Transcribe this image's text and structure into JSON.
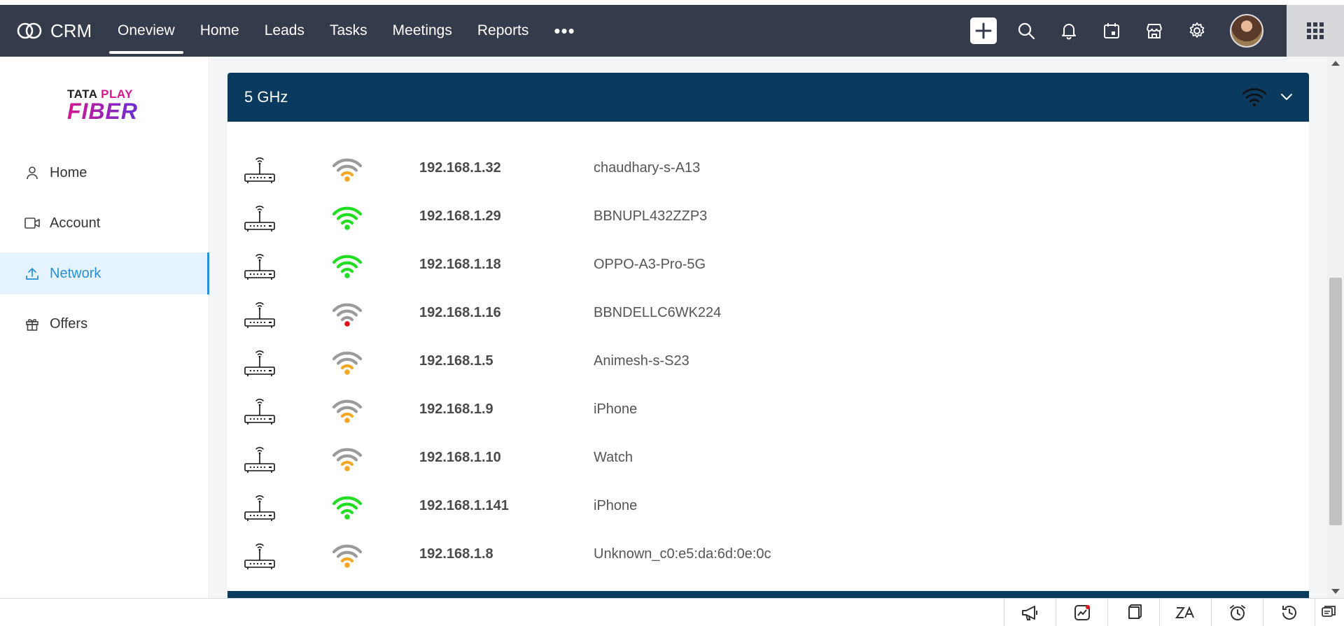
{
  "app": {
    "name": "CRM"
  },
  "nav": {
    "items": [
      {
        "label": "Oneview",
        "active": true
      },
      {
        "label": "Home",
        "active": false
      },
      {
        "label": "Leads",
        "active": false
      },
      {
        "label": "Tasks",
        "active": false
      },
      {
        "label": "Meetings",
        "active": false
      },
      {
        "label": "Reports",
        "active": false
      }
    ],
    "more_label": "•••"
  },
  "header_tools": [
    "add-icon",
    "search-icon",
    "bell-icon",
    "calendar-icon",
    "store-icon",
    "gear-icon",
    "avatar",
    "apps-grid-icon"
  ],
  "brand_logo": {
    "line1_a": "TATA",
    "line1_b": "PLAY",
    "line2": "FIBER"
  },
  "sidebar": {
    "items": [
      {
        "label": "Home",
        "icon": "user-icon",
        "active": false
      },
      {
        "label": "Account",
        "icon": "account-icon",
        "active": false
      },
      {
        "label": "Network",
        "icon": "upload-icon",
        "active": true
      },
      {
        "label": "Offers",
        "icon": "gift-icon",
        "active": false
      }
    ]
  },
  "band": {
    "title": "5 GHz"
  },
  "devices": [
    {
      "ip": "192.168.1.32",
      "name": "chaudhary-s-A13",
      "signal_bars": 2,
      "signal_color": "#f5a623"
    },
    {
      "ip": "192.168.1.29",
      "name": "BBNUPL432ZZP3",
      "signal_bars": 4,
      "signal_color": "#22dd22"
    },
    {
      "ip": "192.168.1.18",
      "name": "OPPO-A3-Pro-5G",
      "signal_bars": 4,
      "signal_color": "#22dd22"
    },
    {
      "ip": "192.168.1.16",
      "name": "BBNDELLC6WK224",
      "signal_bars": 1,
      "signal_color": "#e0121b"
    },
    {
      "ip": "192.168.1.5",
      "name": "Animesh-s-S23",
      "signal_bars": 2,
      "signal_color": "#f5a623"
    },
    {
      "ip": "192.168.1.9",
      "name": "iPhone",
      "signal_bars": 2,
      "signal_color": "#f5a623"
    },
    {
      "ip": "192.168.1.10",
      "name": "Watch",
      "signal_bars": 2,
      "signal_color": "#f5a623"
    },
    {
      "ip": "192.168.1.141",
      "name": "iPhone",
      "signal_bars": 4,
      "signal_color": "#22dd22"
    },
    {
      "ip": "192.168.1.8",
      "name": "Unknown_c0:e5:da:6d:0e:0c",
      "signal_bars": 2,
      "signal_color": "#f5a623"
    }
  ],
  "bottom_tools": [
    "megaphone-icon",
    "analytics-icon",
    "notes-icon",
    "zia-icon",
    "alarm-icon",
    "history-icon",
    "chat-icon"
  ],
  "colors": {
    "topbar": "#343b4a",
    "band": "#0a3a5e",
    "accent": "#2a8fd3",
    "signal_inactive": "#9b9b9b"
  }
}
